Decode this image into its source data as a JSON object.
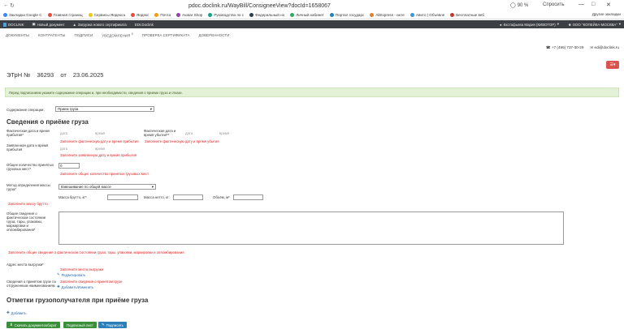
{
  "browser": {
    "url": "pdoc.doclink.ru/WayBill/ConsigneeView?docId=1658067",
    "zoom": "90 %",
    "ask": "Спросить"
  },
  "bookmarks": {
    "items": [
      {
        "label": "Закладки Google C",
        "color": "#4285f4"
      },
      {
        "label": "Главная страниц",
        "color": "#e74c3c"
      },
      {
        "label": "Сервисы Яндекса",
        "color": "#f1c40f"
      },
      {
        "label": "Яндекс",
        "color": "#e74c3c"
      },
      {
        "label": "Почта",
        "color": "#f39c12"
      },
      {
        "label": "Avatar Shop",
        "color": "#8e44ad"
      },
      {
        "label": "Руководство по с",
        "color": "#16a085"
      },
      {
        "label": "Федеральный но",
        "color": "#2c3e50"
      },
      {
        "label": "Личный кабинет",
        "color": "#27ae60"
      },
      {
        "label": "Портал государс",
        "color": "#2980b9"
      },
      {
        "label": "AliExpress - инте",
        "color": "#e67e22"
      },
      {
        "label": "Авито | Объявле",
        "color": "#3498db"
      },
      {
        "label": "Бесплатные веб",
        "color": "#c0392b"
      }
    ],
    "others": "Другие закладки"
  },
  "appbar": {
    "brand": "DOCLINK",
    "new_doc": "Новый документ",
    "upload_cert": "Загрузка нового сертификата",
    "edi": "EDI.Doclink",
    "user": "Екстафьева Мария (КИВОТОР)",
    "org": "ООО \"КОПЕЙКА-МОСКВА\""
  },
  "topnav": [
    "ДОКУМЕНТЫ",
    "КОНТРАГЕНТЫ",
    "ПОДПИСИ",
    "УВЕДОМЛЕНИЯ",
    "ПРОВЕРКА СЕРТИФИКАТА",
    "ДОВЕРЕННОСТИ"
  ],
  "notifications_badge": "0",
  "contacts": {
    "phone": "+7 (495) 737-30-29",
    "email": "edi@doclink.ru"
  },
  "doc": {
    "type": "ЭТрН №",
    "number": "36293",
    "from": "от",
    "date": "23.06.2025"
  },
  "alert": "Перед подписанием укажите содержание операции и, при необходимости, сведения о приеме груза и отказе.",
  "form": {
    "operation_label": "Содержание операции:",
    "operation_value": "Прием груза",
    "section_title": "Сведения о приёме груза",
    "arrival_label": "Фактическая дата и время прибытия*",
    "unload_label": "Фактическая дата и время убытия**",
    "date_placeholder": "дата",
    "time_placeholder": "время",
    "arrival_error": "Заполните фактическую дату и время прибытия",
    "unload_error": "Заполните фактическую дату и время убытия",
    "declared_label": "Заявленная дата и время прибытия",
    "declared_error": "Заполните заявленную дату и время прибытия",
    "places_label": "Общее количество принятых грузовых мест*",
    "places_value": "0",
    "places_error": "Заполните общее количество принятых грузовых мест",
    "method_label": "Метод определения массы груза*",
    "method_value": "Взвешивание по общей массе",
    "gross_label": "Масса брутто, кг*",
    "net_label": "Масса нетто, кг:",
    "volume_label": "Объём, м³",
    "weight_error": "Заполните массу брутто",
    "state_label": "Общие сведения о фактическом состоянии груза, тары, упаковки, маркировки и опломбирования*",
    "state_error": "Заполните общие сведения о фактическом состоянии груза, тары, упаковки, маркировки и опломбирования",
    "address_label": "Адрес места выгрузки*",
    "address_error": "Заполните места выгрузки",
    "address_edit": "Редактировать",
    "goods_label": "Сведения о принятом грузе по отгруженным наименованиям",
    "goods_error": "Заполните сведения о принятом грузе",
    "goods_action": "Добавить/Изменить",
    "marks_title": "Отметки грузополучателя при приёме груза",
    "marks_add": "Добавить"
  },
  "buttons": {
    "download": "Скачать документооборот",
    "sign_more": "Подписный лист",
    "sign": "Подписать"
  }
}
